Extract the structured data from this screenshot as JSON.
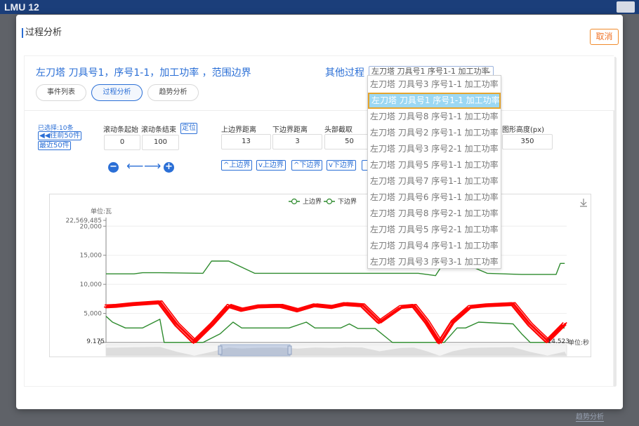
{
  "background": {
    "app_title": "LMU 12",
    "bottom_link": "趋势分析"
  },
  "modal": {
    "title": "过程分析",
    "cancel_label": "取消"
  },
  "header": {
    "heading": "左刀塔  刀具号1，序号1-1，加工功率 ，范围边界",
    "other_label": "其他过程",
    "select_value": "左刀塔 刀具号1 序号1-1 加工功率"
  },
  "tabs": [
    {
      "label": "事件列表",
      "active": false
    },
    {
      "label": "过程分析",
      "active": true
    },
    {
      "label": "趋势分析",
      "active": false
    }
  ],
  "controls": {
    "selected_count": "已选择:10条",
    "prev50": "往前50件",
    "recent50": "最近50件",
    "locate": "定位",
    "scroll_start_label": "滚动条起始",
    "scroll_end_label": "滚动条结束",
    "scroll_start": "0",
    "scroll_end": "100",
    "upper_dist_label": "上边界距离",
    "lower_dist_label": "下边界距离",
    "head_cut_label": "头部截取",
    "graph_height_label": "图形高度(px)",
    "upper_dist": "13",
    "lower_dist": "3",
    "head_cut": "50",
    "graph_height": "350",
    "bound_buttons": [
      "上边界",
      "上边界",
      "下边界",
      "下边界"
    ]
  },
  "dropdown": {
    "options": [
      "左刀塔 刀具号3 序号1-1 加工功率",
      "左刀塔 刀具号1 序号1-1 加工功率",
      "左刀塔 刀具号8 序号1-1 加工功率",
      "左刀塔 刀具号2 序号1-1 加工功率",
      "左刀塔 刀具号3 序号2-1 加工功率",
      "左刀塔 刀具号5 序号1-1 加工功率",
      "左刀塔 刀具号7 序号1-1 加工功率",
      "左刀塔 刀具号6 序号1-1 加工功率",
      "左刀塔 刀具号8 序号2-1 加工功率",
      "左刀塔 刀具号5 序号2-1 加工功率",
      "左刀塔 刀具号4 序号1-1 加工功率",
      "左刀塔 刀具号3 序号3-1 加工功率"
    ],
    "selected_index": 1
  },
  "chart_data": {
    "type": "line",
    "ylabel": "单位:瓦",
    "xlabel": "单位:秒",
    "y_ticks": [
      "22,569,485",
      "20,000",
      "15,000",
      "10,000",
      "5,000",
      "0"
    ],
    "x_start_label": "9.175",
    "x_end_label": "14.523",
    "legend": [
      "上边界",
      "下边界"
    ],
    "x_range": [
      9.175,
      14.523
    ],
    "y_range": [
      0,
      21000
    ],
    "colors": {
      "upper": "#2e8b2e",
      "lower": "#2e8b2e",
      "signal": "#ff0000"
    },
    "series": [
      {
        "name": "上边界",
        "x": [
          9.175,
          9.5,
          9.6,
          9.8,
          10.3,
          10.4,
          10.6,
          10.9,
          11.4,
          12.0,
          12.4,
          12.8,
          13.0,
          13.1,
          13.3,
          13.6,
          14.0,
          14.4,
          14.45,
          14.5
        ],
        "values": [
          11800,
          11800,
          12000,
          12000,
          11900,
          14000,
          14000,
          11900,
          11900,
          11900,
          11900,
          11900,
          11500,
          13800,
          13800,
          11900,
          11700,
          11700,
          13600,
          13600
        ]
      },
      {
        "name": "下边界",
        "x": [
          9.175,
          9.25,
          9.4,
          9.6,
          9.8,
          9.85,
          10.3,
          10.5,
          10.65,
          10.75,
          10.95,
          11.3,
          11.5,
          11.6,
          11.9,
          12.0,
          12.1,
          12.3,
          12.5,
          12.7,
          12.9,
          13.1,
          13.25,
          13.35,
          13.5,
          13.9,
          14.0,
          14.1,
          14.3,
          14.45,
          14.5
        ],
        "values": [
          4500,
          3500,
          2500,
          2500,
          4000,
          0,
          0,
          1500,
          3500,
          2500,
          2500,
          2500,
          3500,
          2500,
          2500,
          3200,
          2400,
          2400,
          0,
          0,
          0,
          0,
          2500,
          2500,
          3500,
          3200,
          1500,
          0,
          0,
          2500,
          2500
        ]
      },
      {
        "name": "",
        "x": [
          9.175,
          9.3,
          9.5,
          9.8,
          10.0,
          10.2,
          10.4,
          10.6,
          10.75,
          10.95,
          11.2,
          11.4,
          11.6,
          11.8,
          11.95,
          12.15,
          12.35,
          12.6,
          12.75,
          12.9,
          13.05,
          13.2,
          13.4,
          13.6,
          13.9,
          14.1,
          14.3,
          14.5
        ],
        "values": [
          6200,
          6300,
          6600,
          6900,
          3000,
          100,
          3000,
          6300,
          5600,
          6200,
          6300,
          5500,
          6400,
          6100,
          6600,
          6400,
          3500,
          6100,
          6300,
          3500,
          0,
          3500,
          6100,
          6400,
          6600,
          3000,
          200,
          3200
        ]
      }
    ]
  }
}
